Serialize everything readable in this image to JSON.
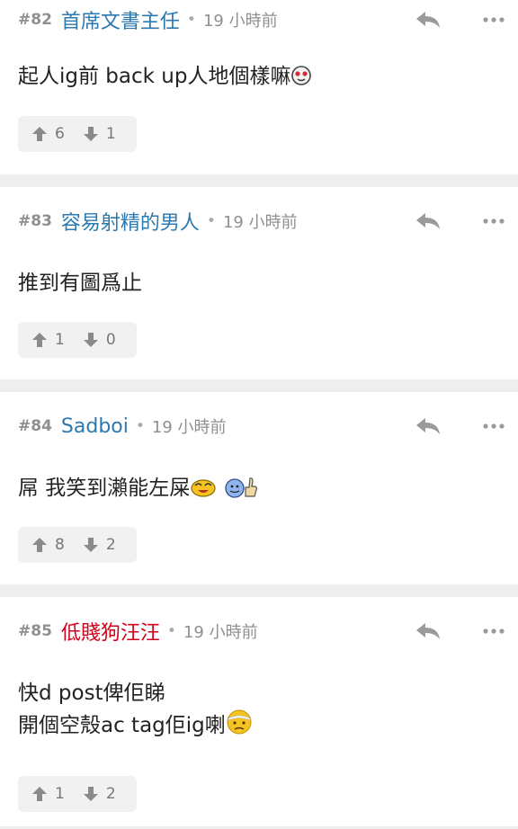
{
  "posts": [
    {
      "num": "#82",
      "username": "首席文書主任",
      "time": "19 小時前",
      "content": "起人ig前 back up人地個樣嘛",
      "up": "6",
      "down": "1"
    },
    {
      "num": "#83",
      "username": "容易射精的男人",
      "time": "19 小時前",
      "content": "推到有圖爲止",
      "up": "1",
      "down": "0"
    },
    {
      "num": "#84",
      "username": "Sadboi",
      "time": "19 小時前",
      "content": "屌 我笑到瀨能左屎",
      "up": "8",
      "down": "2"
    },
    {
      "num": "#85",
      "username": "低賤狗汪汪",
      "time": "19 小時前",
      "content_line1": "快d post俾佢睇",
      "content_line2": "開個空殼ac tag佢ig喇",
      "up": "1",
      "down": "2"
    }
  ],
  "colors": {
    "username_blue": "#2c79b0",
    "username_red": "#d0021b",
    "meta_gray": "#8f8f8f"
  },
  "icons": [
    "reply-icon",
    "more-icon",
    "upvote-icon",
    "downvote-icon"
  ]
}
